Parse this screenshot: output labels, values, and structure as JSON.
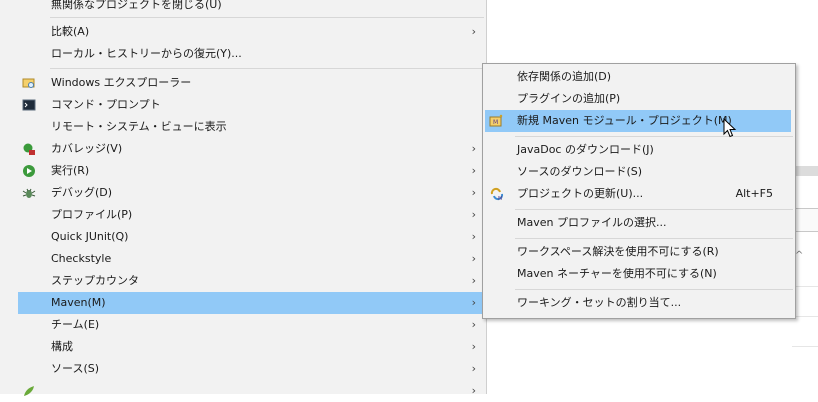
{
  "main_menu": {
    "items": [
      {
        "label": "無関係なプロジェクトを閉じる(U)",
        "arrow": ""
      },
      {
        "label": "比較(A)",
        "arrow": "›"
      },
      {
        "label": "ローカル・ヒストリーからの復元(Y)...",
        "arrow": ""
      },
      {
        "label": "Windows エクスプローラー",
        "arrow": ""
      },
      {
        "label": "コマンド・プロンプト",
        "arrow": ""
      },
      {
        "label": "リモート・システム・ビューに表示",
        "arrow": ""
      },
      {
        "label": "カバレッジ(V)",
        "arrow": "›"
      },
      {
        "label": "実行(R)",
        "arrow": "›"
      },
      {
        "label": "デバッグ(D)",
        "arrow": "›"
      },
      {
        "label": "プロファイル(P)",
        "arrow": "›"
      },
      {
        "label": "Quick JUnit(Q)",
        "arrow": "›"
      },
      {
        "label": "Checkstyle",
        "arrow": "›"
      },
      {
        "label": "ステップカウンタ",
        "arrow": "›"
      },
      {
        "label": "Maven(M)",
        "arrow": "›"
      },
      {
        "label": "チーム(E)",
        "arrow": "›"
      },
      {
        "label": "構成",
        "arrow": "›"
      },
      {
        "label": "ソース(S)",
        "arrow": "›"
      },
      {
        "label": "",
        "arrow": "›"
      }
    ]
  },
  "sub_menu": {
    "items": [
      {
        "label": "依存関係の追加(D)",
        "shortcut": ""
      },
      {
        "label": "プラグインの追加(P)",
        "shortcut": ""
      },
      {
        "label": "新規 Maven モジュール・プロジェクト(M)",
        "shortcut": ""
      },
      {
        "label": "JavaDoc のダウンロード(J)",
        "shortcut": ""
      },
      {
        "label": "ソースのダウンロード(S)",
        "shortcut": ""
      },
      {
        "label": "プロジェクトの更新(U)...",
        "shortcut": "Alt+F5"
      },
      {
        "label": "Maven プロファイルの選択...",
        "shortcut": ""
      },
      {
        "label": "ワークスペース解決を使用不可にする(R)",
        "shortcut": ""
      },
      {
        "label": "Maven ネーチャーを使用不可にする(N)",
        "shortcut": ""
      },
      {
        "label": "ワーキング・セットの割り当て...",
        "shortcut": ""
      }
    ]
  },
  "background": {
    "chevron": "^"
  },
  "colors": {
    "menu_bg": "#f2f2f2",
    "highlight": "#91c9f7",
    "separator": "#d7d7d7"
  }
}
